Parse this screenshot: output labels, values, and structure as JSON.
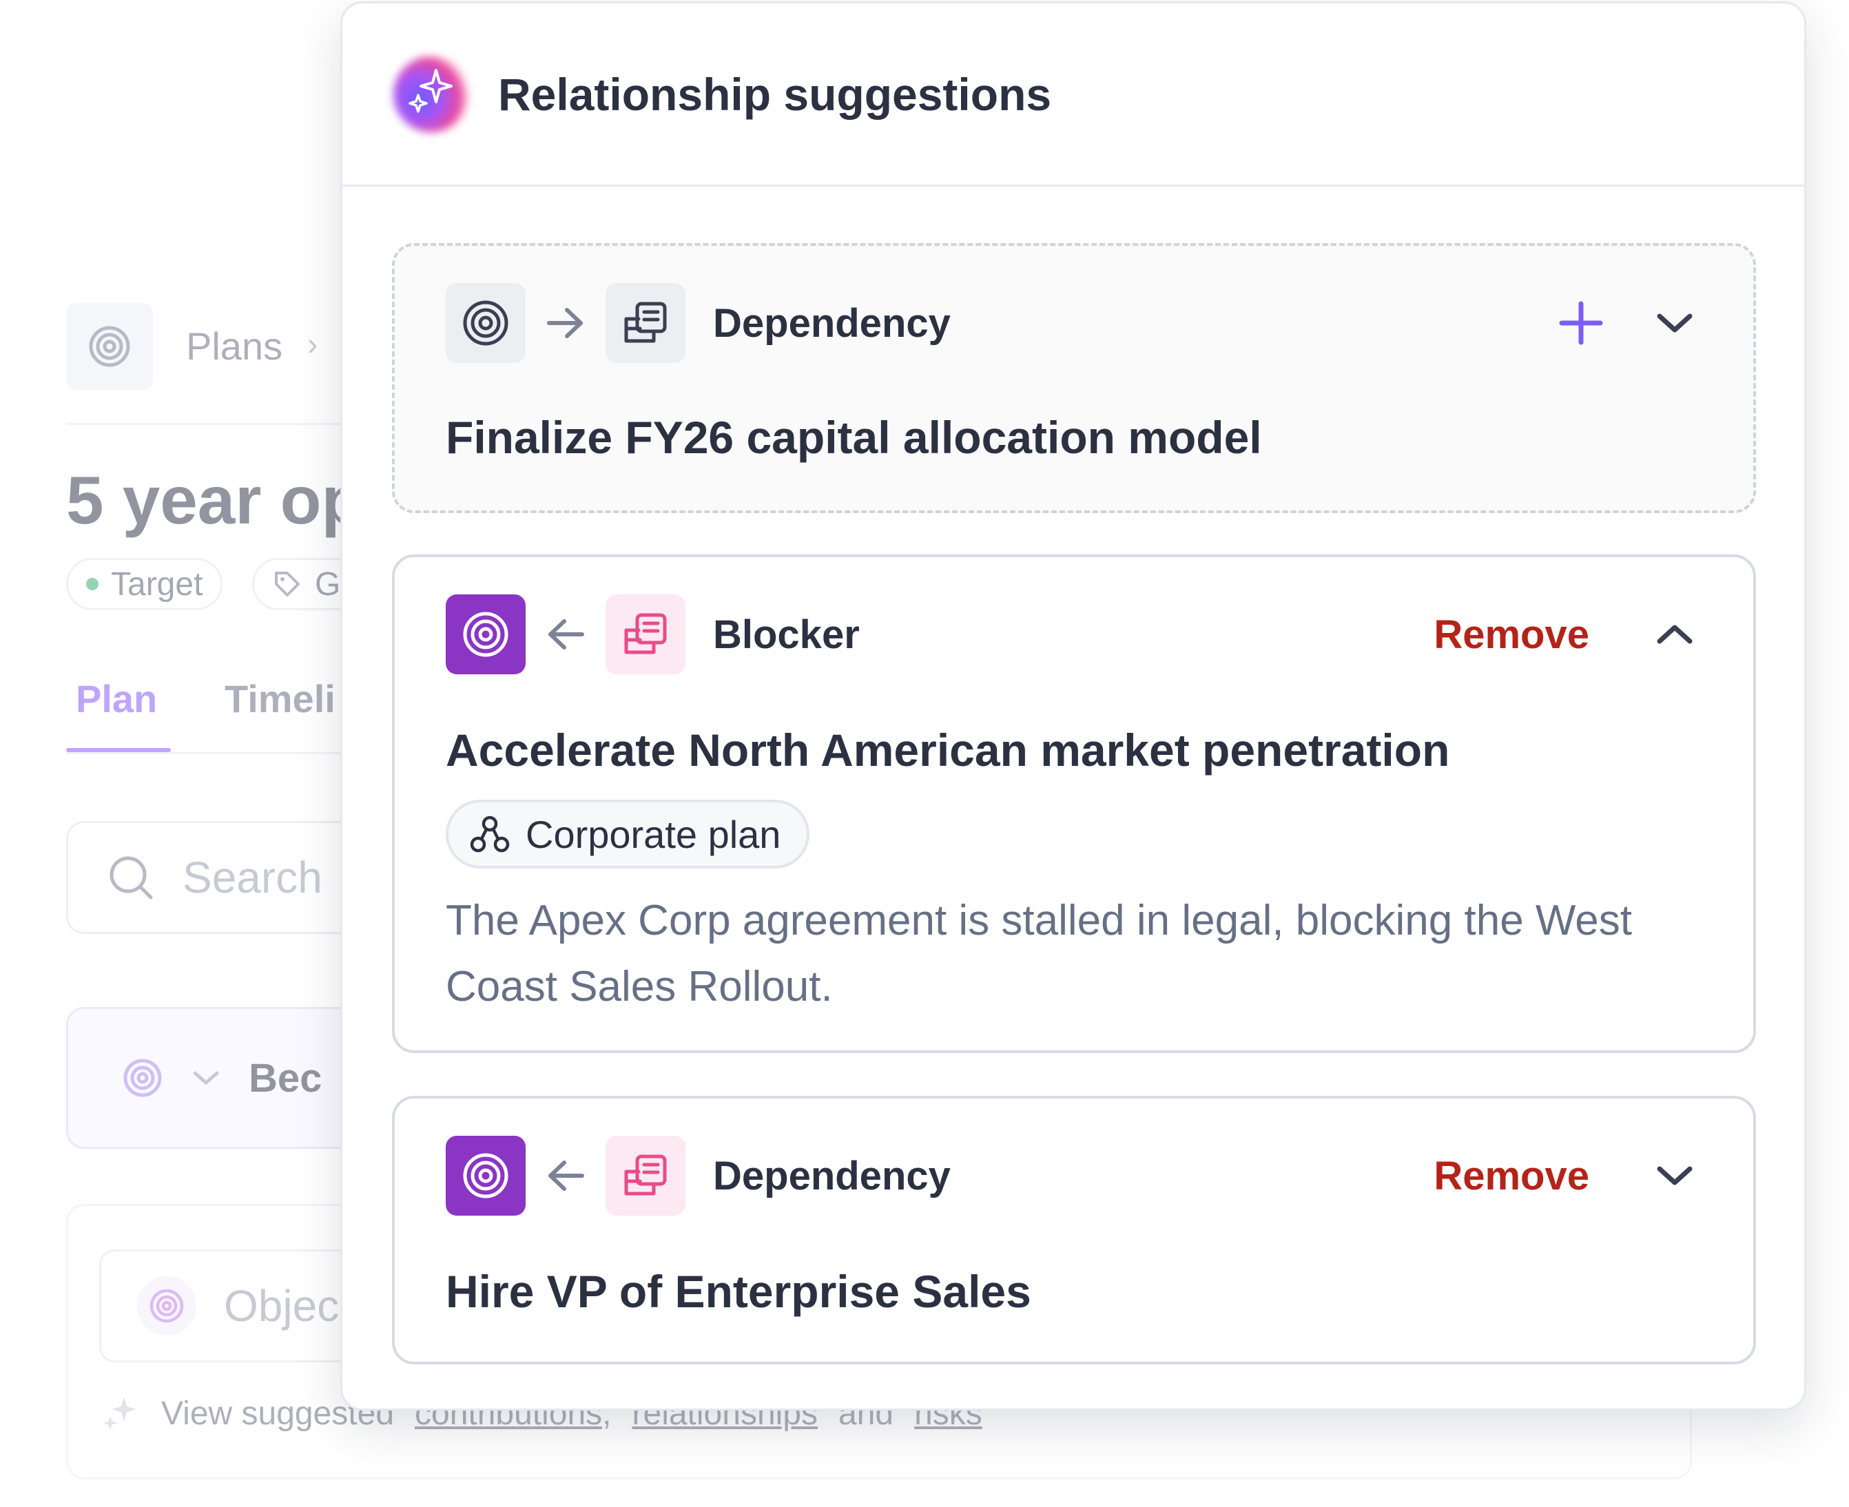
{
  "background": {
    "breadcrumb": {
      "label": "Plans"
    },
    "page_title": "5 year op",
    "chips": [
      {
        "label": "Target"
      },
      {
        "label": "G"
      }
    ],
    "tabs": [
      {
        "label": "Plan",
        "active": true
      },
      {
        "label": "Timeli",
        "active": false
      }
    ],
    "search": {
      "placeholder": "Search"
    },
    "row": {
      "label": "Bec"
    },
    "objective_input": {
      "placeholder": "Objec"
    },
    "footer": {
      "prefix": "View suggested",
      "link1": "contributions",
      "separator": ",",
      "link2": "relationships",
      "middle": "and",
      "link3": "risks"
    }
  },
  "panel": {
    "title": "Relationship suggestions",
    "cards": [
      {
        "state": "suggested",
        "direction": "outgoing",
        "type": "Dependency",
        "action": "add",
        "expanded": false,
        "title": "Finalize FY26 capital allocation model"
      },
      {
        "state": "accepted",
        "direction": "incoming",
        "type": "Blocker",
        "action_label": "Remove",
        "expanded": true,
        "title": "Accelerate North American market penetration",
        "plan": "Corporate plan",
        "description": "The Apex Corp agreement is stalled in legal, blocking the West Coast Sales Rollout."
      },
      {
        "state": "accepted",
        "direction": "incoming",
        "type": "Dependency",
        "action_label": "Remove",
        "expanded": false,
        "title": "Hire VP of Enterprise Sales"
      }
    ]
  },
  "colors": {
    "accent_purple": "#8a35c3",
    "add_purple": "#7c5cf5",
    "remove_red": "#b42318",
    "doc_pink": "#e84b8a",
    "tab_active": "#8b5cf6"
  }
}
